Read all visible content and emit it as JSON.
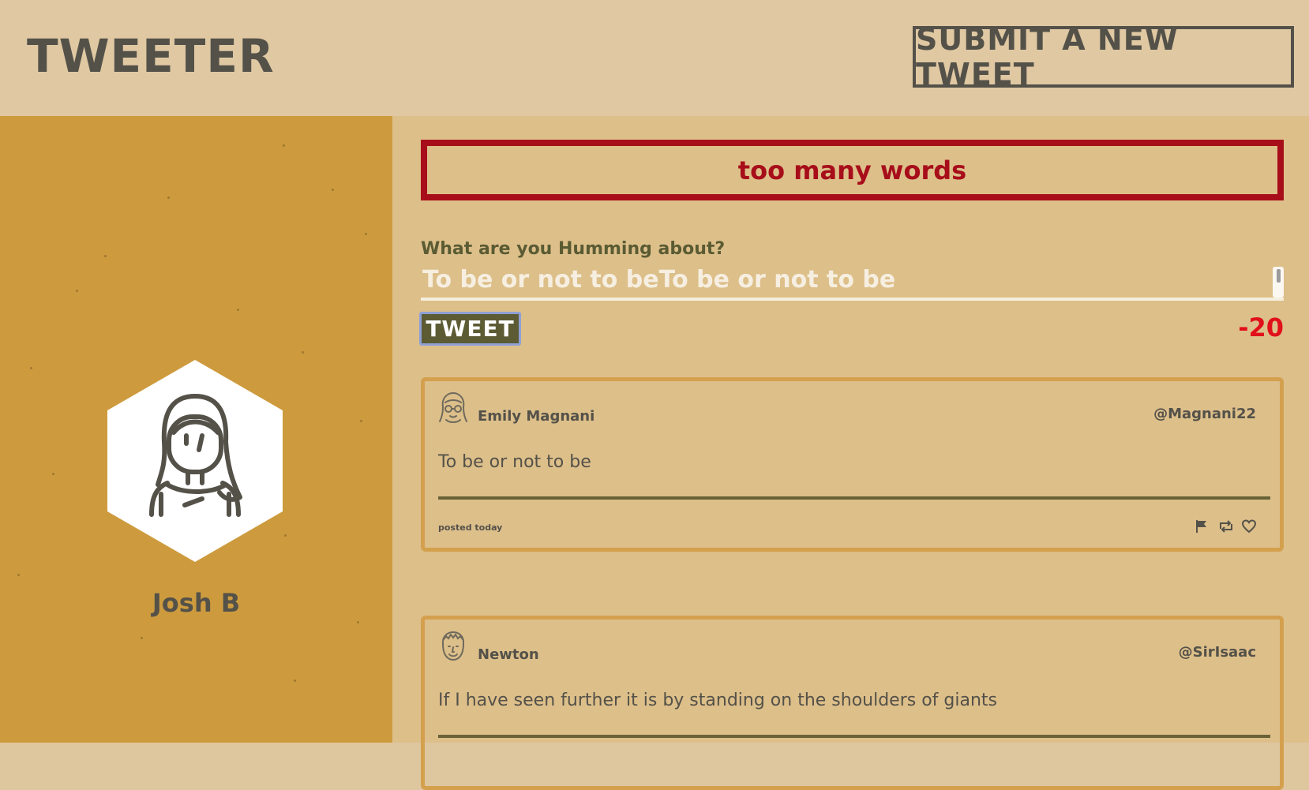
{
  "header": {
    "logo": "TWEETER",
    "new_tweet_button": "SUBMIT A NEW TWEET"
  },
  "sidebar": {
    "profile_name": "Josh B",
    "avatar_icon": "user-avatar-icon"
  },
  "compose": {
    "error": "too many words",
    "label": "What are you Humming about?",
    "text": "To be or not to beTo be or not to be",
    "tweet_button": "TWEET",
    "counter": "-20"
  },
  "tweets": [
    {
      "name": "Emily Magnani",
      "handle": "@Magnani22",
      "body": "To be or not to be",
      "date": "posted today",
      "avatar_icon": "woman-avatar-icon",
      "actions": [
        "flag-icon",
        "retweet-icon",
        "heart-icon"
      ]
    },
    {
      "name": "Newton",
      "handle": "@SirIsaac",
      "body": "If I have seen further it is by standing on the shoulders of giants",
      "avatar_icon": "man-avatar-icon"
    }
  ],
  "colors": {
    "header_bg": "#dfc8a2",
    "sidebar_bg": "#cd9b3e",
    "main_bg": "#ddbf8a",
    "error": "#a70e1a",
    "text_dark": "#545149",
    "counter": "#e1101a",
    "tweet_button_bg": "#5c5b34"
  }
}
